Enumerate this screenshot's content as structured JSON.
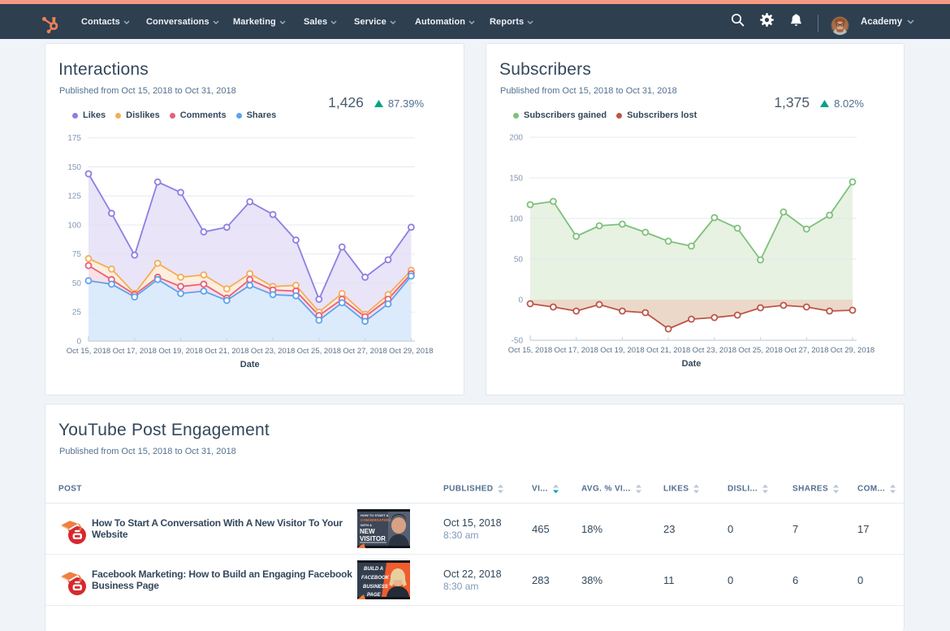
{
  "topnav": {
    "brand": "HubSpot",
    "items": [
      {
        "label": "Contacts"
      },
      {
        "label": "Conversations"
      },
      {
        "label": "Marketing"
      },
      {
        "label": "Sales"
      },
      {
        "label": "Service"
      },
      {
        "label": "Automation"
      },
      {
        "label": "Reports"
      }
    ],
    "account_label": "Academy",
    "colors": {
      "strip": "#f59a82",
      "bar": "#2e3f50",
      "logo": "#f47c33"
    }
  },
  "cards": {
    "interactions": {
      "title": "Interactions",
      "subtitle": "Published from Oct 15, 2018 to Oct 31, 2018",
      "metric_value": "1,426",
      "metric_delta": "87.39%",
      "delta_color": "#00a38a"
    },
    "subscribers": {
      "title": "Subscribers",
      "subtitle": "Published from Oct 15, 2018 to Oct 31, 2018",
      "metric_value": "1,375",
      "metric_delta": "8.02%",
      "delta_color": "#00a38a"
    },
    "table": {
      "title": "YouTube Post Engagement",
      "subtitle": "Published from Oct 15, 2018 to Oct 31, 2018",
      "columns": [
        {
          "label": "POST",
          "sortable": false
        },
        {
          "label": "PUBLISHED",
          "sortable": true
        },
        {
          "label": "VI...",
          "sortable": true,
          "sorted": "desc",
          "sort_color": "#00a4bd"
        },
        {
          "label": "AVG. % VI...",
          "sortable": true
        },
        {
          "label": "LIKES",
          "sortable": true
        },
        {
          "label": "DISLI...",
          "sortable": true
        },
        {
          "label": "SHARES",
          "sortable": true
        },
        {
          "label": "COM...",
          "sortable": true
        }
      ],
      "rows": [
        {
          "title": "How To Start A Conversation With A New Visitor To Your Website",
          "thumb_lines": [
            "HOW TO START A",
            "CONVERSATION",
            "WITH A",
            "NEW",
            "VISITOR"
          ],
          "date": "Oct 15, 2018",
          "time": "8:30 am",
          "views": "465",
          "avg_viewed": "18%",
          "likes": "23",
          "dislikes": "0",
          "shares": "7",
          "comments": "17"
        },
        {
          "title": "Facebook Marketing: How to Build an Engaging Facebook Business Page",
          "thumb_lines": [
            "BUILD A",
            "FACEBOOK",
            "BUSINESS",
            "PAGE"
          ],
          "date": "Oct 22, 2018",
          "time": "8:30 am",
          "views": "283",
          "avg_viewed": "38%",
          "likes": "11",
          "dislikes": "0",
          "shares": "6",
          "comments": "0"
        }
      ]
    }
  },
  "chart_data": [
    {
      "type": "line",
      "title": "Interactions",
      "xlabel": "Date",
      "x_tick_labels": [
        "Oct 15, 2018",
        "Oct 17, 2018",
        "Oct 19, 2018",
        "Oct 21, 2018",
        "Oct 23, 2018",
        "Oct 25, 2018",
        "Oct 27, 2018",
        "Oct 29, 2018"
      ],
      "points_per_tick": 2,
      "ylim": [
        0,
        175
      ],
      "ytick_step": 25,
      "grid": true,
      "legend_position": "top",
      "series": [
        {
          "name": "Likes",
          "color": "#8d7fe3",
          "fill": "#e9e4f8",
          "values": [
            144,
            110,
            74,
            137,
            128,
            94,
            98,
            120,
            109,
            87,
            36,
            81,
            55,
            70,
            98
          ]
        },
        {
          "name": "Dislikes",
          "color": "#f5ad56",
          "fill": "#fdeedd",
          "values": [
            71,
            62,
            41,
            67,
            55,
            57,
            45,
            58,
            47,
            48,
            25,
            41,
            23,
            40,
            61
          ]
        },
        {
          "name": "Comments",
          "color": "#e75f7d",
          "fill": "#fadfe7",
          "values": [
            65,
            53,
            40,
            55,
            47,
            49,
            37,
            53,
            44,
            43,
            22,
            36,
            21,
            36,
            58
          ]
        },
        {
          "name": "Shares",
          "color": "#5ba3f0",
          "fill": "#dcebfb",
          "values": [
            52,
            49,
            38,
            53,
            41,
            43,
            35,
            48,
            40,
            39,
            18,
            33,
            17,
            32,
            56
          ]
        }
      ]
    },
    {
      "type": "line",
      "title": "Subscribers",
      "xlabel": "Date",
      "x_tick_labels": [
        "Oct 15, 2018",
        "Oct 17, 2018",
        "Oct 19, 2018",
        "Oct 21, 2018",
        "Oct 23, 2018",
        "Oct 25, 2018",
        "Oct 27, 2018",
        "Oct 29, 2018"
      ],
      "points_per_tick": 2,
      "ylim": [
        -50,
        200
      ],
      "ytick_step": 50,
      "grid": true,
      "legend_position": "top",
      "series": [
        {
          "name": "Subscribers gained",
          "color": "#7ec079",
          "fill": "#e7f2e2",
          "values": [
            117,
            121,
            78,
            91,
            93,
            83,
            72,
            66,
            101,
            88,
            49,
            108,
            87,
            104,
            145
          ]
        },
        {
          "name": "Subscribers lost",
          "color": "#bd5547",
          "fill": "#ebd8c9",
          "values": [
            -5,
            -9,
            -14,
            -6,
            -14,
            -16,
            -36,
            -24,
            -22,
            -19,
            -10,
            -7,
            -9,
            -14,
            -13
          ]
        }
      ]
    }
  ]
}
